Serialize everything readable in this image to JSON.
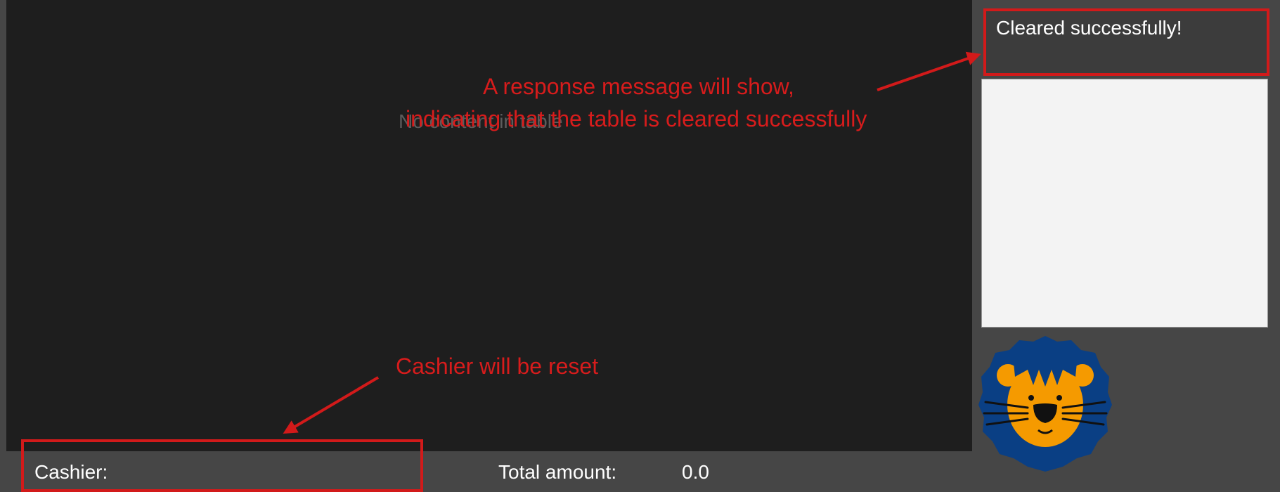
{
  "table": {
    "empty_message": "No content in table"
  },
  "status_bar": {
    "cashier_label": "Cashier:",
    "total_label": "Total amount:",
    "total_value": "0.0"
  },
  "response": {
    "message": "Cleared successfully!"
  },
  "annotations": {
    "response_line1": "A response message will show,",
    "response_line2": "indicating that the table is cleared successfully",
    "cashier": "Cashier will be reset"
  },
  "logo": {
    "icon": "lion-icon"
  },
  "colors": {
    "annotation": "#d71c1c",
    "table_background": "#1e1e1e",
    "window_background": "#464646",
    "lion_mane": "#0a3f84",
    "lion_face": "#f59a00"
  }
}
